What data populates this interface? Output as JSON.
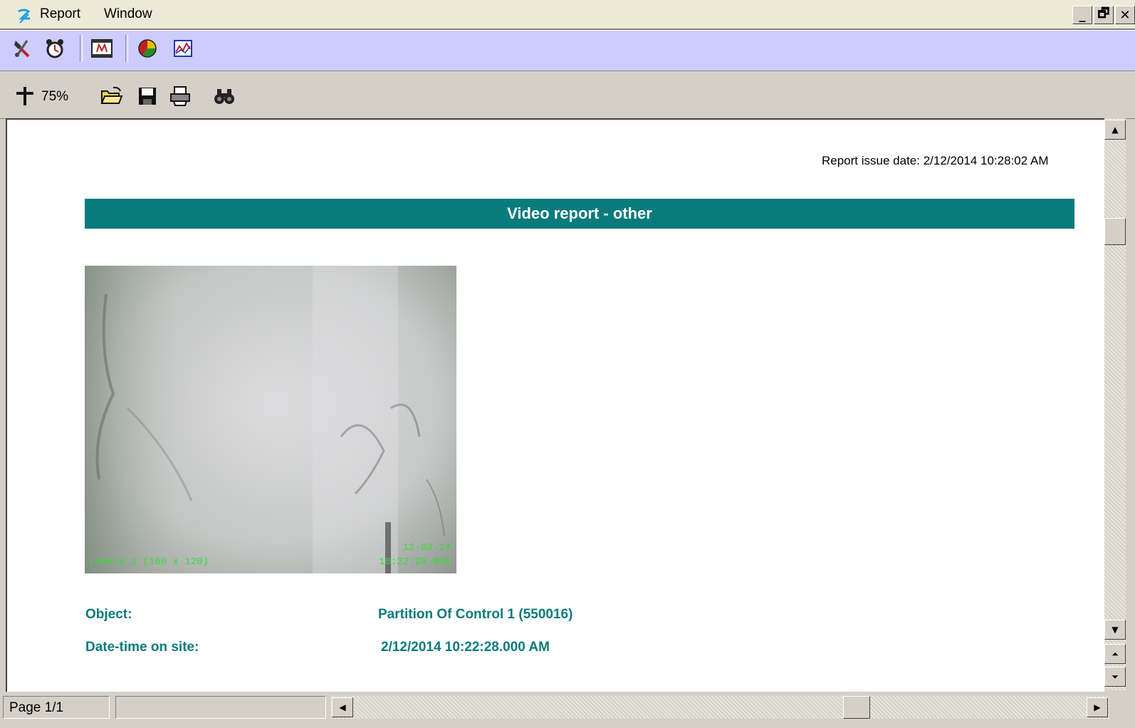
{
  "menu": {
    "items": [
      "Report",
      "Window"
    ]
  },
  "window_controls": {
    "minimize": "_",
    "restore": "🗗",
    "close": "✕"
  },
  "toolbar1": {
    "icons": [
      "tools-icon",
      "alarm-clock-icon",
      "video-film-icon",
      "pie-chart-icon",
      "line-chart-icon"
    ]
  },
  "toolbar2": {
    "zoom": "75%",
    "icons": [
      "zoom-tool-icon",
      "open-folder-icon",
      "save-icon",
      "print-icon",
      "find-binoculars-icon"
    ]
  },
  "report": {
    "issue_date": "Report issue date: 2/12/2014 10:28:02 AM",
    "title": "Video report - other",
    "camera": {
      "label": "Lamera 1 (160 x 120)",
      "date": "12-02-14",
      "time": "10:22:28.000"
    },
    "fields": [
      {
        "label": "Object:",
        "value": "Partition Of Control 1 (550016)"
      },
      {
        "label": "Date-time on site:",
        "value": "2/12/2014 10:22:28.000 AM"
      }
    ]
  },
  "status": {
    "page": "Page 1/1"
  },
  "colors": {
    "accent_teal": "#0a7b7b",
    "toolbar_lilac": "#ccccff",
    "chrome": "#d4d0c8"
  }
}
